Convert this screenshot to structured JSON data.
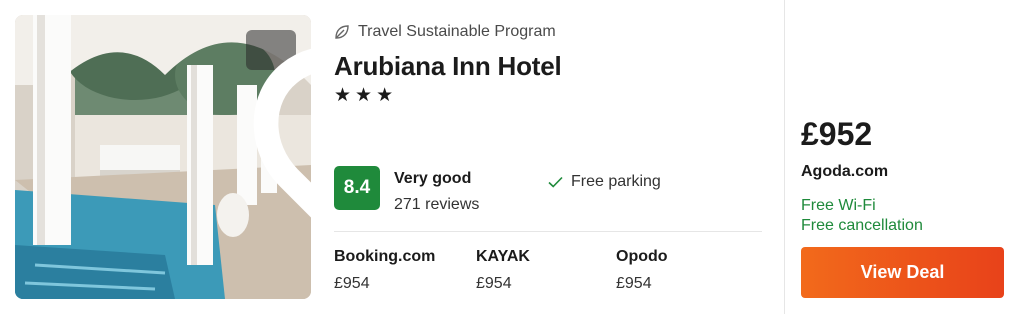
{
  "hotel": {
    "program": "Travel Sustainable Program",
    "program_icon": "leaf-icon",
    "name": "Arubiana Inn Hotel",
    "stars": [
      "★",
      "★",
      "★"
    ],
    "score": "8.4",
    "rating_word": "Very good",
    "review_count": "271 reviews",
    "amenity": "Free parking",
    "amenity_icon": "check-icon",
    "favorite_icon": "heart-icon"
  },
  "partners": [
    {
      "name": "Booking.com",
      "price": "£954"
    },
    {
      "name": "KAYAK",
      "price": "£954"
    },
    {
      "name": "Opodo",
      "price": "£954"
    }
  ],
  "deal": {
    "price": "£952",
    "provider": "Agoda.com",
    "perks": [
      "Free Wi-Fi",
      "Free cancellation"
    ],
    "button_label": "View Deal"
  },
  "colors": {
    "score_badge": "#1f8a3b",
    "perk_text": "#1f8a3b",
    "button_start": "#f26a1b",
    "button_end": "#e8421a"
  }
}
